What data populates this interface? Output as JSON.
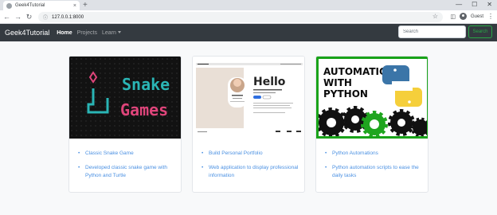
{
  "browser": {
    "tab_title": "Geek4Tutorial",
    "url": "127.0.0.1:8000",
    "profile_label": "Guest",
    "tab_close": "×",
    "new_tab": "+",
    "window_buttons": [
      "—",
      "☐",
      "✕"
    ],
    "nav_back": "←",
    "nav_forward": "→",
    "nav_reload": "↻",
    "info_icon": "ⓘ",
    "star_icon": "☆",
    "sidebar_icon": "◫",
    "menu_icon": "⋮"
  },
  "navbar": {
    "brand": "Geek4Tutorial",
    "links": [
      {
        "label": "Home",
        "active": true
      },
      {
        "label": "Projects",
        "active": false
      },
      {
        "label": "Learn",
        "active": false,
        "dropdown": true
      }
    ],
    "search_placeholder": "Search",
    "search_button": "Search"
  },
  "cards": [
    {
      "title": "Classic Snake Game",
      "description": "Developed classic snake game with Python and Turtle",
      "image_caption_lines": [
        "Snake",
        "Games"
      ]
    },
    {
      "title": "Build Personal Portfolio",
      "description": "Web application to display professional information",
      "image_heading": "Hello"
    },
    {
      "title": "Python Automations",
      "description": "Python automation scripts to ease the daily tasks",
      "image_caption_lines": [
        "AUTOMATION",
        "WITH",
        "PYTHON"
      ]
    }
  ],
  "colors": {
    "navbar_bg": "#343a40",
    "link_blue": "#4a90e2",
    "search_green": "#28a745",
    "automation_border": "#19a319",
    "snake_teal": "#2ab5b5",
    "snake_pink": "#e0457b"
  }
}
